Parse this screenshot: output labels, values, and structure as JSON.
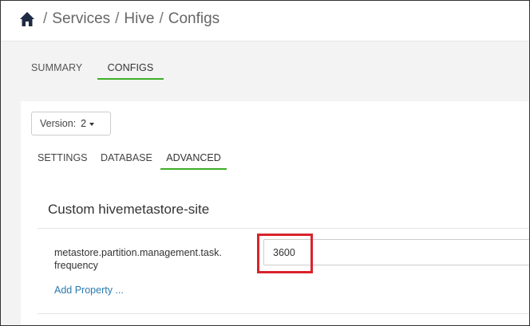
{
  "breadcrumb": {
    "home_icon": "home-icon",
    "separator": "/",
    "items": [
      "Services",
      "Hive",
      "Configs"
    ]
  },
  "top_tabs": [
    {
      "label": "SUMMARY",
      "active": false
    },
    {
      "label": "CONFIGS",
      "active": true
    }
  ],
  "version": {
    "label": "Version:",
    "value": "2"
  },
  "sub_tabs": [
    {
      "label": "SETTINGS",
      "active": false
    },
    {
      "label": "DATABASE",
      "active": false
    },
    {
      "label": "ADVANCED",
      "active": true
    }
  ],
  "section": {
    "title": "Custom hivemetastore-site",
    "property": {
      "name": "metastore.partition.management.task.\nfrequency",
      "value": "3600"
    },
    "add_property_label": "Add Property ..."
  },
  "colors": {
    "accent_green": "#3fae29",
    "highlight_red": "#d9232d",
    "link_blue": "#2a7ab0"
  }
}
